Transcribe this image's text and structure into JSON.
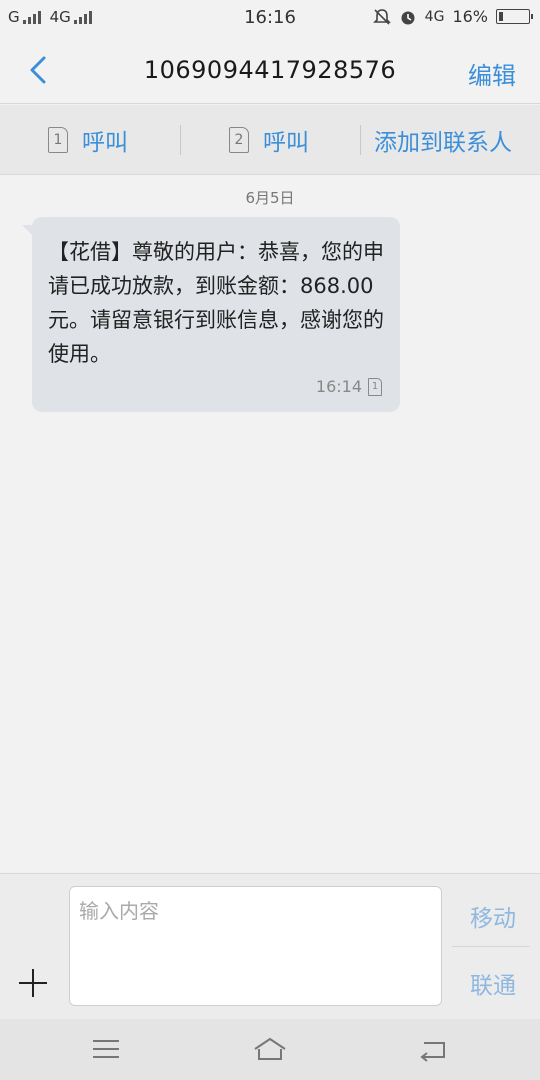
{
  "status_bar": {
    "carrier1": "G",
    "carrier2": "4G",
    "time": "16:16",
    "network_badge": "4G",
    "battery_text": "16%",
    "battery_level": 0.16
  },
  "header": {
    "title": "1069094417928576",
    "edit_label": "编辑",
    "back_icon": "chevron-left-icon"
  },
  "actions": {
    "call1_sim": "1",
    "call1_label": "呼叫",
    "call2_sim": "2",
    "call2_label": "呼叫",
    "add_contact_label": "添加到联系人"
  },
  "conversation": {
    "date": "6月5日",
    "messages": [
      {
        "text": "【花借】尊敬的用户：恭喜，您的申请已成功放款，到账金额：868.00元。请留意银行到账信息，感谢您的使用。",
        "time": "16:14",
        "sim": "1"
      }
    ]
  },
  "composer": {
    "placeholder": "输入内容",
    "option1": "移动",
    "option2": "联通"
  },
  "colors": {
    "accent": "#3b8fd9",
    "bubble": "#dfe2e7",
    "background": "#f2f2f2"
  }
}
